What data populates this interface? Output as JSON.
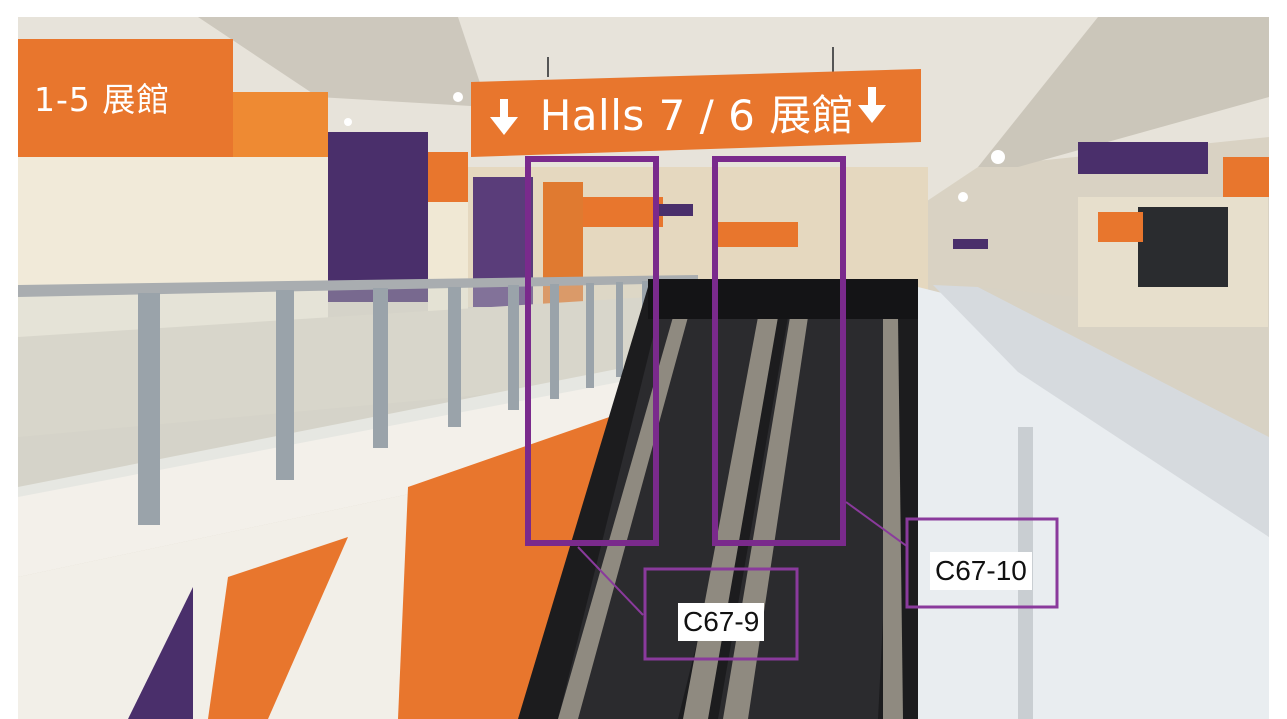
{
  "signs": {
    "halls_left": "1-5 展館",
    "halls_main": "Halls 7 / 6 展館"
  },
  "annotations": {
    "escalator_left": "C67-9",
    "escalator_right": "C67-10"
  },
  "colors": {
    "sign_orange": "#e8762d",
    "annotation_purple": "#7a2a8c",
    "wall_purple": "#4a2f6b"
  }
}
